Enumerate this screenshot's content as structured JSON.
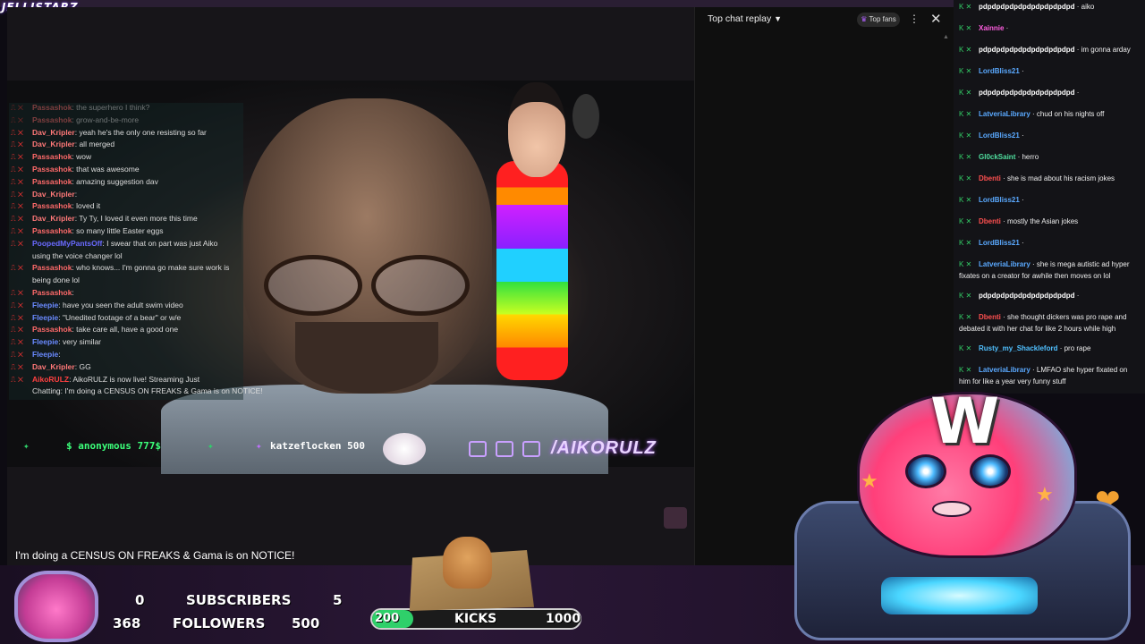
{
  "brand": "JELLISTARZ",
  "overlay_chat": [
    {
      "user": "Passashok",
      "text": "the superhero I think?",
      "color": "#ff6a6a"
    },
    {
      "user": "Passashok",
      "text": "grow-and-be-more",
      "color": "#ff6a6a"
    },
    {
      "user": "Dav_Kripler",
      "text": "yeah he's the only one resisting so far",
      "color": "#ff7878"
    },
    {
      "user": "Dav_Kripler",
      "text": "all merged",
      "color": "#ff7878"
    },
    {
      "user": "Passashok",
      "text": "wow",
      "color": "#ff6a6a"
    },
    {
      "user": "Passashok",
      "text": "that was awesome",
      "color": "#ff6a6a"
    },
    {
      "user": "Passashok",
      "text": "amazing suggestion dav",
      "color": "#ff6a6a"
    },
    {
      "user": "Dav_Kripler",
      "text": "",
      "color": "#ff7878"
    },
    {
      "user": "Passashok",
      "text": "loved it",
      "color": "#ff6a6a"
    },
    {
      "user": "Dav_Kripler",
      "text": "Ty Ty, I loved it even more this time",
      "color": "#ff7878"
    },
    {
      "user": "Passashok",
      "text": "so many little Easter eggs",
      "color": "#ff6a6a"
    },
    {
      "user": "PoopedMyPantsOff",
      "text": "I swear that on part was just Aiko",
      "color": "#6a6aff"
    },
    {
      "user": "",
      "text": "using the voice changer lol",
      "color": "#ddd"
    },
    {
      "user": "Passashok",
      "text": "who knows... I'm gonna go make sure work is",
      "color": "#ff6a6a"
    },
    {
      "user": "",
      "text": "being done lol",
      "color": "#ddd"
    },
    {
      "user": "Passashok",
      "text": "",
      "color": "#ff6a6a"
    },
    {
      "user": "Fleepie",
      "text": "have you seen the adult swim video",
      "color": "#6a8aff"
    },
    {
      "user": "Fleepie",
      "text": "\"Unedited footage of a bear\" or w/e",
      "color": "#6a8aff"
    },
    {
      "user": "Passashok",
      "text": "take care all, have a good one",
      "color": "#ff6a6a"
    },
    {
      "user": "Fleepie",
      "text": "very similar",
      "color": "#6a8aff"
    },
    {
      "user": "Fleepie",
      "text": "",
      "color": "#6a8aff"
    },
    {
      "user": "Dav_Kripler",
      "text": "GG",
      "color": "#ff7878"
    },
    {
      "user": "AikoRULZ",
      "text": "AikoRULZ is now live! Streaming Just",
      "color": "#ff4040"
    },
    {
      "user": "",
      "text": "Chatting: I'm doing a CENSUS ON FREAKS & Gama is on NOTICE!",
      "color": "#ddd"
    }
  ],
  "ticker": {
    "anonymous": "$ anonymous 777$",
    "katze": "katzeflocken 500"
  },
  "social": "/AIKORULZ",
  "stream_title": "I'm doing a CENSUS ON FREAKS & Gama is on NOTICE!",
  "replay": {
    "title": "Top chat replay",
    "top_fans": "Top fans"
  },
  "right_chat": [
    {
      "user": "pdpdpdpdpdpdpdpdpdpdpd",
      "text": "aiko",
      "color": "#ffffff"
    },
    {
      "user": "Xainnie",
      "text": "",
      "color": "#ff5ee0"
    },
    {
      "user": "pdpdpdpdpdpdpdpdpdpdpd",
      "text": "im gonna arday",
      "color": "#ffffff"
    },
    {
      "user": "LordBliss21",
      "text": "",
      "color": "#5aa9ff"
    },
    {
      "user": "pdpdpdpdpdpdpdpdpdpdpd",
      "text": "",
      "color": "#ffffff"
    },
    {
      "user": "LatveriaLibrary",
      "text": "chud on his nights off",
      "color": "#5aa9ff"
    },
    {
      "user": "LordBliss21",
      "text": "",
      "color": "#5aa9ff"
    },
    {
      "user": "Gl0ckSaint",
      "text": "herro",
      "color": "#50e0a0"
    },
    {
      "user": "Dbenti",
      "text": "she is mad about his racism jokes",
      "color": "#ff5050"
    },
    {
      "user": "LordBliss21",
      "text": "",
      "color": "#5aa9ff"
    },
    {
      "user": "Dbenti",
      "text": "mostly the Asian jokes",
      "color": "#ff5050"
    },
    {
      "user": "LordBliss21",
      "text": "",
      "color": "#5aa9ff"
    },
    {
      "user": "LatveriaLibrary",
      "text": "she is mega autistic ad hyper fixates on a creator for awhile then moves on lol",
      "color": "#5aa9ff"
    },
    {
      "user": "pdpdpdpdpdpdpdpdpdpdpd",
      "text": "",
      "color": "#ffffff"
    },
    {
      "user": "Dbenti",
      "text": "she thought dickers was pro rape and debated it with her chat for like 2 hours while high",
      "color": "#ff5050"
    },
    {
      "user": "Rusty_my_Shackleford",
      "text": "pro rape",
      "color": "#50c0ff"
    },
    {
      "user": "LatveriaLibrary",
      "text": "LMFAO she hyper fixated on him for like a year very funny stuff",
      "color": "#5aa9ff"
    }
  ],
  "stats": {
    "subs_current": "0",
    "subs_label": "SUBSCRIBERS",
    "subs_goal": "5",
    "followers_current": "368",
    "followers_label": "FOLLOWERS",
    "followers_goal": "500",
    "kicks_current": "200",
    "kicks_label": "KICKS",
    "kicks_goal": "1000",
    "kicks_progress": 0.2
  },
  "mascot_letter": "W",
  "colors": {
    "accent": "#2fd06a",
    "brand": "#b060ff"
  }
}
